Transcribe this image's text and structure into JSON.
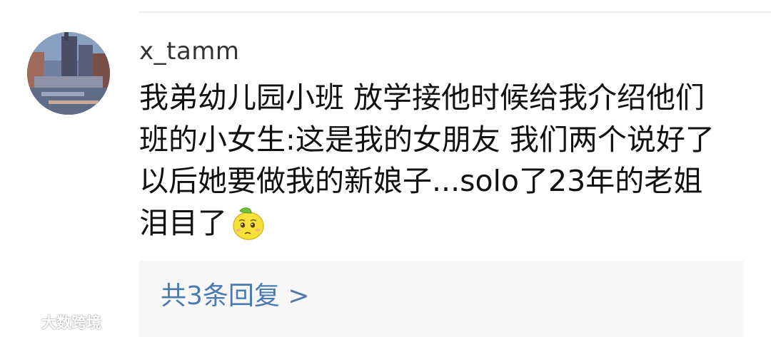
{
  "comment": {
    "username": "x_tamm",
    "lines": [
      "我弟幼儿园小班 放学接他时候给我介绍他们",
      "班的小女生:这是我的女朋友 我们两个说好了",
      "以后她要做我的新娘子...solo了23年的老姐",
      "泪目了"
    ],
    "emoji": "lemon-crying-icon"
  },
  "replies": {
    "label": "共3条回复 >"
  },
  "watermark": {
    "text": "大数跨境"
  },
  "colors": {
    "link": "#4a7ab0",
    "reply_box_bg": "#f7f7f7",
    "text": "#111111",
    "username": "#333333"
  }
}
